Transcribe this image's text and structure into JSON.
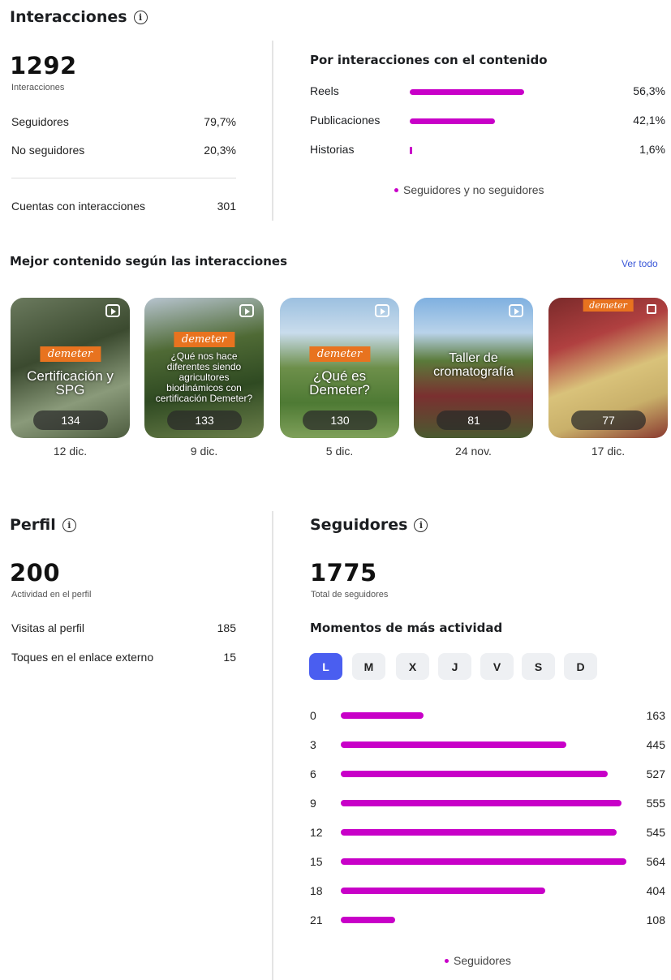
{
  "interacciones": {
    "title": "Interacciones",
    "total": "1292",
    "total_label": "Interacciones",
    "rows": [
      {
        "label": "Seguidores",
        "value": "79,7%"
      },
      {
        "label": "No seguidores",
        "value": "20,3%"
      }
    ],
    "accounts": {
      "label": "Cuentas con interacciones",
      "value": "301"
    }
  },
  "por_contenido": {
    "title": "Por interacciones con el contenido",
    "items": [
      {
        "label": "Reels",
        "value": "56,3%",
        "percent": 56.3
      },
      {
        "label": "Publicaciones",
        "value": "42,1%",
        "percent": 42.1
      },
      {
        "label": "Historias",
        "value": "1,6%",
        "percent": 1.6
      }
    ],
    "legend": "Seguidores y no seguidores",
    "bar_color": "#c800c8"
  },
  "mejor_contenido": {
    "title": "Mejor contenido según las interacciones",
    "link": "Ver todo",
    "items": [
      {
        "count": "134",
        "date": "12 dic.",
        "badge": "demeter",
        "caption": "Certificación y SPG",
        "icon": "reel-icon"
      },
      {
        "count": "133",
        "date": "9 dic.",
        "badge": "demeter",
        "caption": "¿Qué nos hace diferentes siendo agricultores biodinámicos con certificación Demeter?",
        "icon": "reel-icon"
      },
      {
        "count": "130",
        "date": "5 dic.",
        "badge": "demeter",
        "caption": "¿Qué es Demeter?",
        "icon": "reel-icon"
      },
      {
        "count": "81",
        "date": "24 nov.",
        "badge": "",
        "caption": "Taller de cromatografía",
        "icon": "reel-icon"
      },
      {
        "count": "77",
        "date": "17 dic.",
        "badge": "demeter",
        "caption": "",
        "icon": "post-icon"
      }
    ]
  },
  "perfil": {
    "title": "Perfil",
    "total": "200",
    "total_label": "Actividad en el perfil",
    "rows": [
      {
        "label": "Visitas al perfil",
        "value": "185"
      },
      {
        "label": "Toques en el enlace externo",
        "value": "15"
      }
    ]
  },
  "seguidores": {
    "title": "Seguidores",
    "total": "1775",
    "total_label": "Total de seguidores",
    "activity_title": "Momentos de más actividad",
    "days": [
      "L",
      "M",
      "X",
      "J",
      "V",
      "S",
      "D"
    ],
    "selected_day": "L",
    "legend": "Seguidores",
    "accent_color": "#4a5ef0"
  },
  "chart_data": {
    "type": "bar",
    "orientation": "horizontal",
    "categories": [
      "0",
      "3",
      "6",
      "9",
      "12",
      "15",
      "18",
      "21"
    ],
    "series": [
      {
        "name": "Seguidores",
        "values": [
          163,
          445,
          527,
          555,
          545,
          564,
          404,
          108
        ]
      }
    ],
    "legend": "bottom-center",
    "grid": false
  }
}
